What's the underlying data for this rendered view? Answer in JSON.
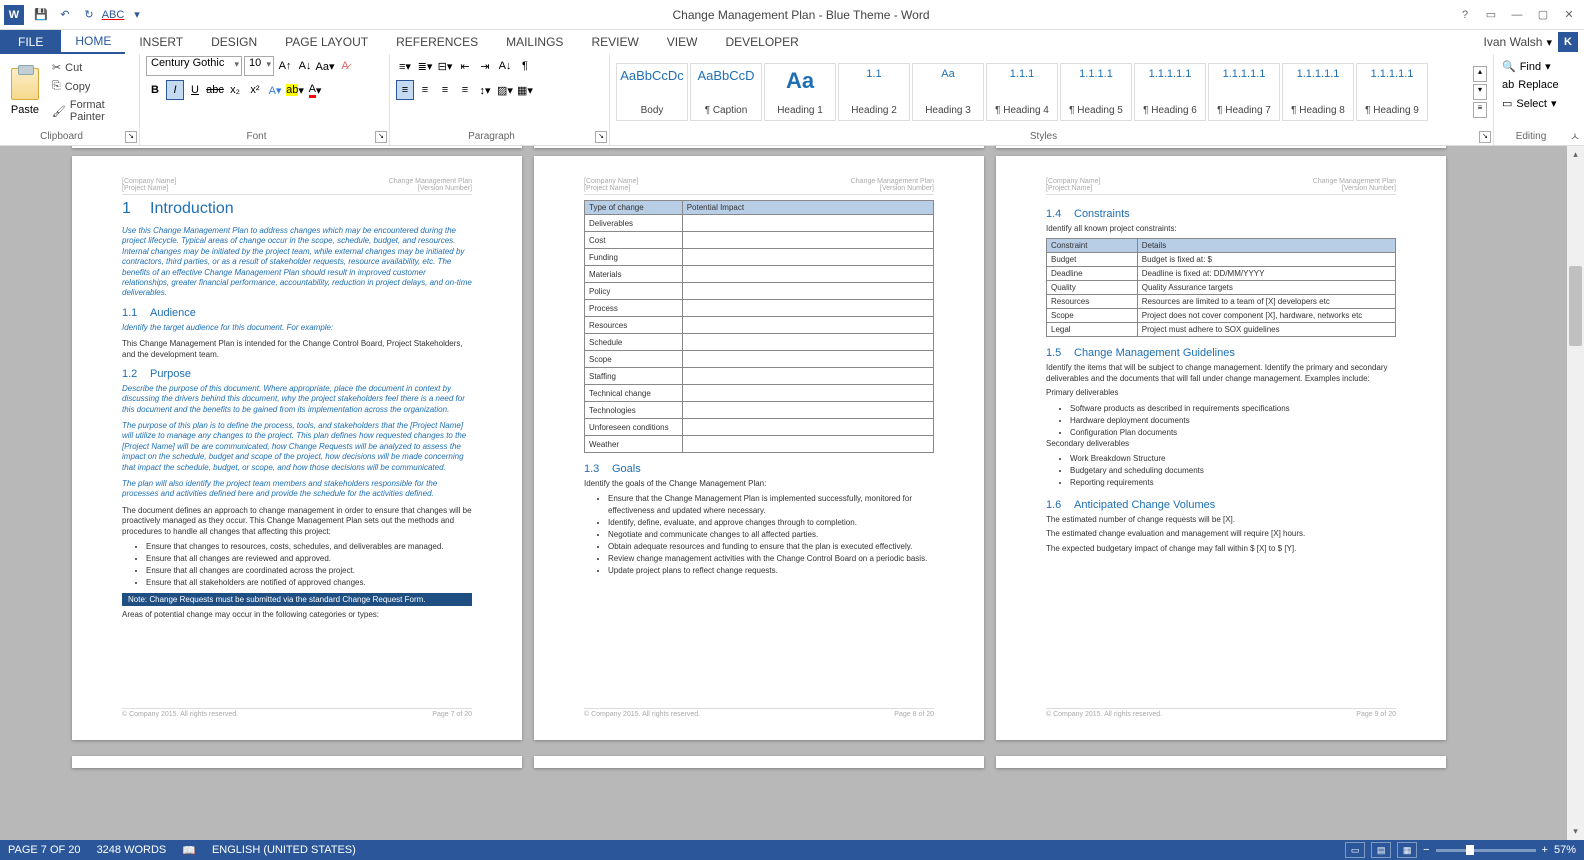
{
  "title": "Change Management Plan - Blue Theme - Word",
  "user": {
    "name": "Ivan Walsh",
    "dropdown": "▾",
    "initial": "K"
  },
  "tabs": {
    "file": "FILE",
    "home": "HOME",
    "insert": "INSERT",
    "design": "DESIGN",
    "pagelayout": "PAGE LAYOUT",
    "references": "REFERENCES",
    "mailings": "MAILINGS",
    "review": "REVIEW",
    "view": "VIEW",
    "developer": "DEVELOPER"
  },
  "clipboard": {
    "paste": "Paste",
    "cut": "Cut",
    "copy": "Copy",
    "format_painter": "Format Painter",
    "label": "Clipboard"
  },
  "font": {
    "name": "Century Gothic",
    "size": "10",
    "label": "Font",
    "bold": "B",
    "italic": "I",
    "underline": "U",
    "strike": "abc",
    "sub": "x₂",
    "sup": "x²"
  },
  "paragraph": {
    "label": "Paragraph"
  },
  "styles": {
    "label": "Styles",
    "items": [
      {
        "preview": "AaBbCcDc",
        "label": "Body"
      },
      {
        "preview": "AaBbCcD",
        "label": "¶ Caption"
      },
      {
        "preview": "Aa",
        "label": "Heading 1"
      },
      {
        "preview": "1.1",
        "label": "Heading 2"
      },
      {
        "preview": "Aa",
        "label": "Heading 3"
      },
      {
        "preview": "1.1.1",
        "label": "¶ Heading 4"
      },
      {
        "preview": "1.1.1.1",
        "label": "¶ Heading 5"
      },
      {
        "preview": "1.1.1.1.1",
        "label": "¶ Heading 6"
      },
      {
        "preview": "1.1.1.1.1",
        "label": "¶ Heading 7"
      },
      {
        "preview": "1.1.1.1.1",
        "label": "¶ Heading 8"
      },
      {
        "preview": "1.1.1.1.1",
        "label": "¶ Heading 9"
      }
    ]
  },
  "editing": {
    "find": "Find",
    "replace": "Replace",
    "select": "Select",
    "label": "Editing"
  },
  "status": {
    "page": "PAGE 7 OF 20",
    "words": "3248 WORDS",
    "lang": "ENGLISH (UNITED STATES)",
    "zoom": "57%"
  },
  "pages": {
    "header_left_1": "[Company Name]",
    "header_left_2": "[Project Name]",
    "header_right_1": "Change Management Plan",
    "header_right_2": "[Version Number]",
    "footer_left": "© Company 2015. All rights reserved.",
    "footer_p1": "Page 7 of 20",
    "footer_p2": "Page 8 of 20",
    "footer_p3": "Page 9 of 20"
  },
  "doc1": {
    "h1_num": "1",
    "h1": "Introduction",
    "intro_italic": "Use this Change Management Plan to address changes which may be encountered during the project lifecycle. Typical areas of change occur in the scope, schedule, budget, and resources. Internal changes may be initiated by the project team, while external changes may be initiated by contractors, third parties, or as a result of stakeholder requests, resource availability, etc. The benefits of an effective Change Management Plan should result in improved customer relationships, greater financial performance, accountability, reduction in project delays, and on-time deliverables.",
    "s11_num": "1.1",
    "s11": "Audience",
    "s11_italic": "Identify the target audience for this document. For example:",
    "s11_body": "This Change Management Plan is intended for the Change Control Board, Project Stakeholders, and the development team.",
    "s12_num": "1.2",
    "s12": "Purpose",
    "s12_italic1": "Describe the purpose of this document. Where appropriate, place the document in context by discussing the drivers behind this document, why the project stakeholders feel there is a need for this document and the benefits to be gained from its implementation across the organization.",
    "s12_italic2": "The purpose of this plan is to define the process, tools, and stakeholders that the [Project Name] will utilize to manage any changes to the project. This plan defines how requested changes to the [Project Name] will be are communicated, how Change Requests will be analyzed to assess the impact on the schedule, budget and scope of the project, how decisions will be made concerning that impact the schedule, budget, or scope, and how those decisions will be communicated.",
    "s12_italic3": "The plan will also identify the project team members and stakeholders responsible for the processes and activities defined here and provide the schedule for the activities defined.",
    "s12_body": "The document defines an approach to change management in order to ensure that changes will be proactively managed as they occur. This Change Management Plan sets out the methods and procedures to handle all changes that affecting this project:",
    "s12_bullets": [
      "Ensure that changes to resources, costs, schedules, and deliverables are managed.",
      "Ensure that all changes are reviewed and approved.",
      "Ensure that all changes are coordinated across the project.",
      "Ensure that all stakeholders are notified of approved changes."
    ],
    "note": "Note: Change Requests must be submitted via the standard Change Request Form.",
    "s12_tail": "Areas of potential change may occur in the following categories or types:"
  },
  "doc2": {
    "table_headers": [
      "Type of change",
      "Potential Impact"
    ],
    "table_rows": [
      "Deliverables",
      "Cost",
      "Funding",
      "Materials",
      "Policy",
      "Process",
      "Resources",
      "Schedule",
      "Scope",
      "Staffing",
      "Technical change",
      "Technologies",
      "Unforeseen conditions",
      "Weather"
    ],
    "s13_num": "1.3",
    "s13": "Goals",
    "s13_body": "Identify the goals of the Change Management Plan:",
    "s13_bullets": [
      "Ensure that the Change Management Plan is implemented successfully, monitored for effectiveness and updated where necessary.",
      "Identify, define, evaluate, and approve changes through to completion.",
      "Negotiate and communicate changes to all affected parties.",
      "Obtain adequate resources and funding to ensure that the plan is executed effectively.",
      "Review change management activities with the Change Control Board on a periodic basis.",
      "Update project plans to reflect change requests."
    ]
  },
  "doc3": {
    "s14_num": "1.4",
    "s14": "Constraints",
    "s14_body": "Identify all known project constraints:",
    "table_headers": [
      "Constraint",
      "Details"
    ],
    "table_rows": [
      [
        "Budget",
        "Budget is fixed at: $"
      ],
      [
        "Deadline",
        "Deadline is fixed at: DD/MM/YYYY"
      ],
      [
        "Quality",
        "Quality Assurance targets"
      ],
      [
        "Resources",
        "Resources are limited to a team of [X] developers etc"
      ],
      [
        "Scope",
        "Project does not cover component [X], hardware, networks etc"
      ],
      [
        "Legal",
        "Project must adhere to SOX guidelines"
      ]
    ],
    "s15_num": "1.5",
    "s15": "Change Management Guidelines",
    "s15_body": "Identify the items that will be subject to change management. Identify the primary and secondary deliverables and the documents that will fall under change management. Examples include:",
    "s15_primary": "Primary deliverables",
    "s15_primary_bullets": [
      "Software products as described in requirements specifications",
      "Hardware deployment documents",
      "Configuration Plan documents"
    ],
    "s15_secondary": "Secondary deliverables",
    "s15_secondary_bullets": [
      "Work Breakdown Structure",
      "Budgetary and scheduling documents",
      "Reporting requirements"
    ],
    "s16_num": "1.6",
    "s16": "Anticipated Change Volumes",
    "s16_p1": "The estimated number of change requests will be [X].",
    "s16_p2": "The estimated change evaluation and management will require [X] hours.",
    "s16_p3": "The expected budgetary impact of change may fall within $ [X] to $ [Y]."
  }
}
